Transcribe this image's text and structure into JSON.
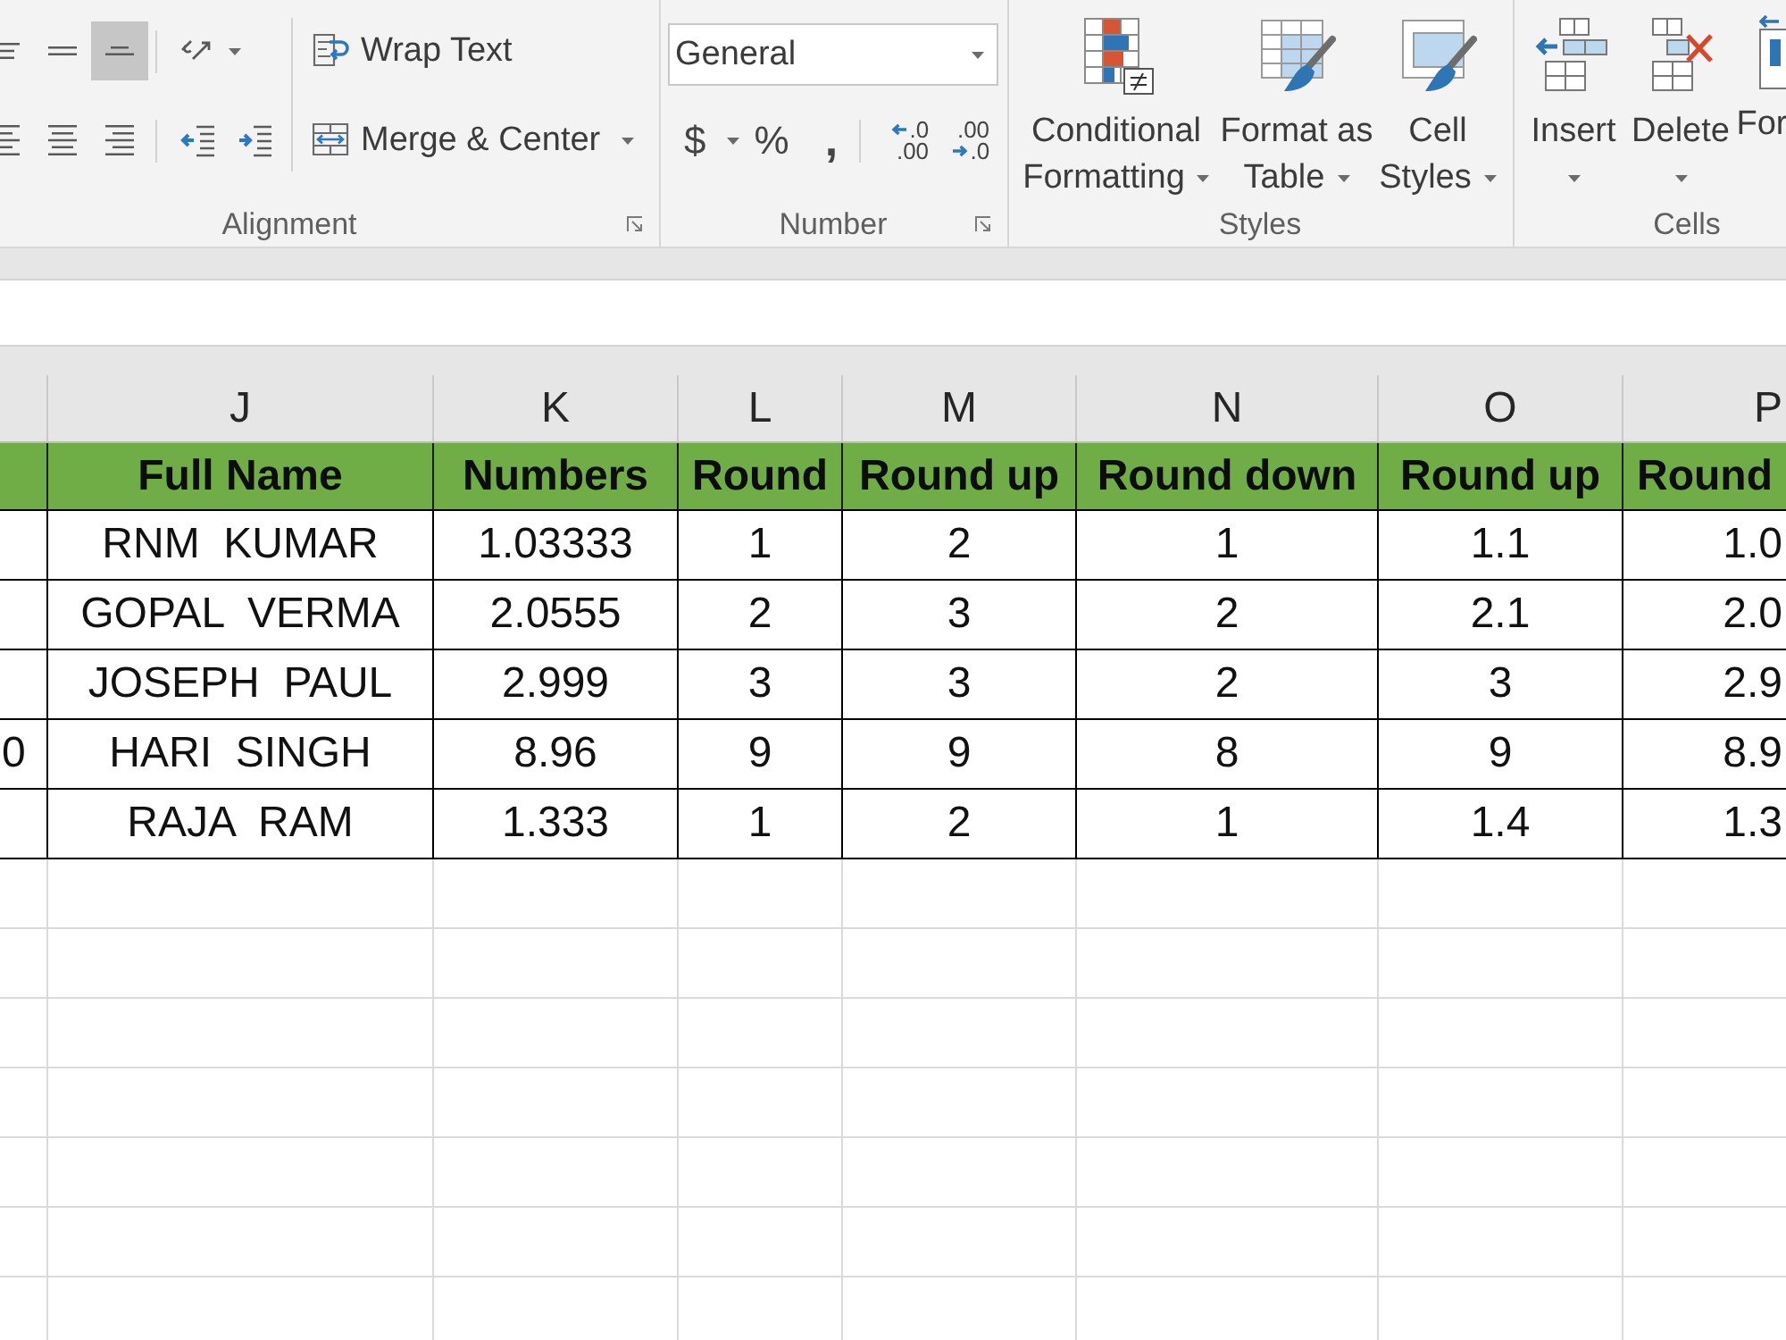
{
  "ribbon": {
    "alignment": {
      "vertical": [
        {
          "kind": "top",
          "selected": false
        },
        {
          "kind": "middle",
          "selected": false
        },
        {
          "kind": "bottom",
          "selected": true
        }
      ],
      "horizontal": [
        {
          "kind": "left",
          "selected": false
        },
        {
          "kind": "center",
          "selected": false
        },
        {
          "kind": "right",
          "selected": false
        }
      ],
      "wrap_text": "Wrap Text",
      "merge_center": "Merge & Center",
      "label": "Alignment"
    },
    "number": {
      "format": "General",
      "currency": "$",
      "percent": "%",
      "comma": ",",
      "decimals": [
        {
          "kind": "increase",
          "top": ".0",
          "bottom": ".00"
        },
        {
          "kind": "decrease",
          "top": ".00",
          "bottom": ".0"
        }
      ],
      "label": "Number"
    },
    "styles": {
      "buttons": [
        {
          "kind": "conditional",
          "lines": [
            "Conditional",
            "Formatting"
          ]
        },
        {
          "kind": "table",
          "lines": [
            "Format as",
            "Table"
          ]
        },
        {
          "kind": "cell_styles",
          "lines": [
            "Cell",
            "Styles"
          ]
        }
      ],
      "label": "Styles"
    },
    "cells": {
      "buttons": [
        {
          "kind": "insert",
          "label": "Insert"
        },
        {
          "kind": "delete",
          "label": "Delete"
        },
        {
          "kind": "format",
          "label": "For"
        }
      ],
      "label": "Cells"
    }
  },
  "sheet": {
    "column_letters": [
      "J",
      "K",
      "L",
      "M",
      "N",
      "O",
      "P"
    ],
    "header_row": [
      "Full Name",
      "Numbers",
      "Round",
      "Round up",
      "Round down",
      "Round up",
      "Round"
    ],
    "rows": [
      {
        "cells": [
          "RNM  KUMAR",
          "1.03333",
          "1",
          "2",
          "1",
          "1.1",
          "1.0"
        ]
      },
      {
        "cells": [
          "GOPAL  VERMA",
          "2.0555",
          "2",
          "3",
          "2",
          "2.1",
          "2.0"
        ]
      },
      {
        "cells": [
          "JOSEPH  PAUL",
          "2.999",
          "3",
          "3",
          "2",
          "3",
          "2.9"
        ]
      },
      {
        "edge_cell": "0",
        "cells": [
          "HARI  SINGH",
          "8.96",
          "9",
          "9",
          "8",
          "9",
          "8.9"
        ]
      },
      {
        "cells": [
          "RAJA  RAM",
          "1.333",
          "1",
          "2",
          "1",
          "1.4",
          "1.3"
        ]
      }
    ]
  }
}
